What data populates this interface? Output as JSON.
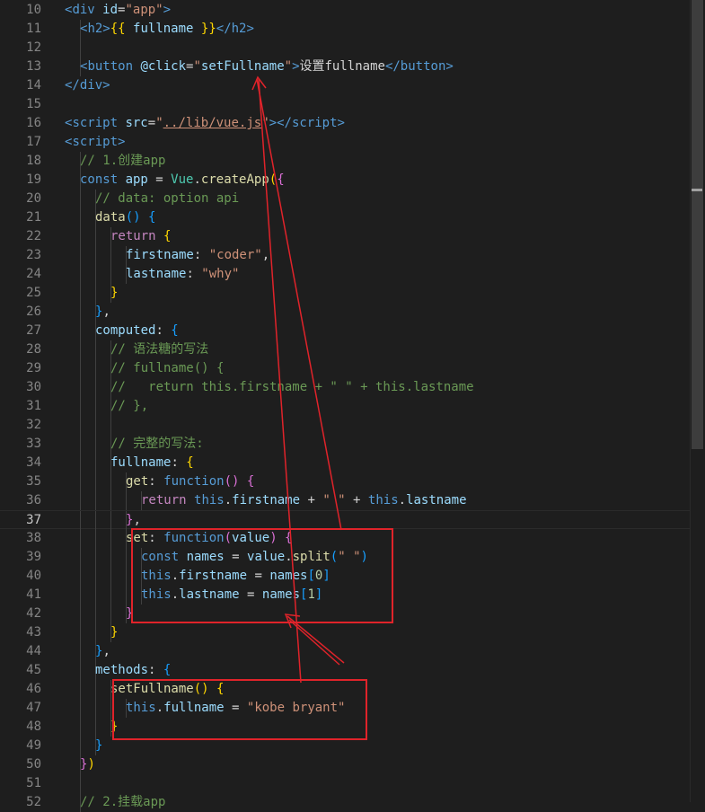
{
  "editor": {
    "current_line": 37,
    "lines": [
      {
        "n": "10",
        "indent": 1,
        "tokens": [
          [
            "<",
            "tag"
          ],
          [
            "div",
            "tag"
          ],
          [
            " ",
            ""
          ],
          [
            "id",
            "attr"
          ],
          [
            "=",
            "punc"
          ],
          [
            "\"app\"",
            "str"
          ],
          [
            ">",
            "tag"
          ]
        ]
      },
      {
        "n": "11",
        "indent": 2,
        "tokens": [
          [
            "<",
            "tag"
          ],
          [
            "h2",
            "tag"
          ],
          [
            ">",
            "tag"
          ],
          [
            "{{ ",
            "b1"
          ],
          [
            "fullname",
            "var"
          ],
          [
            " }}",
            "b1"
          ],
          [
            "</",
            "tag"
          ],
          [
            "h2",
            "tag"
          ],
          [
            ">",
            "tag"
          ]
        ]
      },
      {
        "n": "12",
        "indent": 2,
        "tokens": []
      },
      {
        "n": "13",
        "indent": 2,
        "tokens": [
          [
            "<",
            "tag"
          ],
          [
            "button",
            "tag"
          ],
          [
            " ",
            ""
          ],
          [
            "@click",
            "attr"
          ],
          [
            "=",
            "punc"
          ],
          [
            "\"",
            "str"
          ],
          [
            "setFullname",
            "var"
          ],
          [
            "\"",
            "str"
          ],
          [
            ">",
            "tag"
          ],
          [
            "设置fullname",
            "plain"
          ],
          [
            "</",
            "tag"
          ],
          [
            "button",
            "tag"
          ],
          [
            ">",
            "tag"
          ]
        ]
      },
      {
        "n": "14",
        "indent": 1,
        "tokens": [
          [
            "</",
            "tag"
          ],
          [
            "div",
            "tag"
          ],
          [
            ">",
            "tag"
          ]
        ]
      },
      {
        "n": "15",
        "indent": 0,
        "tokens": []
      },
      {
        "n": "16",
        "indent": 1,
        "tokens": [
          [
            "<",
            "tag"
          ],
          [
            "script",
            "tag"
          ],
          [
            " ",
            ""
          ],
          [
            "src",
            "attr"
          ],
          [
            "=",
            "punc"
          ],
          [
            "\"",
            "str"
          ],
          [
            "../lib/vue.js",
            "str link"
          ],
          [
            "\"",
            "str"
          ],
          [
            "></",
            "tag"
          ],
          [
            "script",
            "tag"
          ],
          [
            ">",
            "tag"
          ]
        ]
      },
      {
        "n": "17",
        "indent": 1,
        "tokens": [
          [
            "<",
            "tag"
          ],
          [
            "script",
            "tag"
          ],
          [
            ">",
            "tag"
          ]
        ]
      },
      {
        "n": "18",
        "indent": 2,
        "tokens": [
          [
            "// 1.创建app",
            "cmt"
          ]
        ]
      },
      {
        "n": "19",
        "indent": 2,
        "tokens": [
          [
            "const ",
            "kw"
          ],
          [
            "app",
            "var"
          ],
          [
            " = ",
            "plain"
          ],
          [
            "Vue",
            "cls"
          ],
          [
            ".",
            "plain"
          ],
          [
            "createApp",
            "fn"
          ],
          [
            "(",
            "b1"
          ],
          [
            "{",
            "b2"
          ]
        ]
      },
      {
        "n": "20",
        "indent": 3,
        "tokens": [
          [
            "// data: option api",
            "cmt"
          ]
        ]
      },
      {
        "n": "21",
        "indent": 3,
        "tokens": [
          [
            "data",
            "fn"
          ],
          [
            "() ",
            "b3"
          ],
          [
            "{",
            "b3"
          ]
        ]
      },
      {
        "n": "22",
        "indent": 4,
        "tokens": [
          [
            "return ",
            "ctrl"
          ],
          [
            "{",
            "b1"
          ]
        ]
      },
      {
        "n": "23",
        "indent": 5,
        "tokens": [
          [
            "firstname",
            "var"
          ],
          [
            ": ",
            "plain"
          ],
          [
            "\"coder\"",
            "str"
          ],
          [
            ",",
            "plain"
          ]
        ]
      },
      {
        "n": "24",
        "indent": 5,
        "tokens": [
          [
            "lastname",
            "var"
          ],
          [
            ": ",
            "plain"
          ],
          [
            "\"why\"",
            "str"
          ]
        ]
      },
      {
        "n": "25",
        "indent": 4,
        "tokens": [
          [
            "}",
            "b1"
          ]
        ]
      },
      {
        "n": "26",
        "indent": 3,
        "tokens": [
          [
            "}",
            "b3"
          ],
          [
            ",",
            "plain"
          ]
        ]
      },
      {
        "n": "27",
        "indent": 3,
        "tokens": [
          [
            "computed",
            "var"
          ],
          [
            ": ",
            "plain"
          ],
          [
            "{",
            "b3"
          ]
        ]
      },
      {
        "n": "28",
        "indent": 4,
        "tokens": [
          [
            "// 语法糖的写法",
            "cmt"
          ]
        ]
      },
      {
        "n": "29",
        "indent": 4,
        "tokens": [
          [
            "// fullname() {",
            "cmt"
          ]
        ]
      },
      {
        "n": "30",
        "indent": 4,
        "tokens": [
          [
            "//   return this.firstname + \" \" + this.lastname",
            "cmt"
          ]
        ]
      },
      {
        "n": "31",
        "indent": 4,
        "tokens": [
          [
            "// },",
            "cmt"
          ]
        ]
      },
      {
        "n": "32",
        "indent": 4,
        "tokens": []
      },
      {
        "n": "33",
        "indent": 4,
        "tokens": [
          [
            "// 完整的写法:",
            "cmt"
          ]
        ]
      },
      {
        "n": "34",
        "indent": 4,
        "tokens": [
          [
            "fullname",
            "var"
          ],
          [
            ": ",
            "plain"
          ],
          [
            "{",
            "b1"
          ]
        ]
      },
      {
        "n": "35",
        "indent": 5,
        "tokens": [
          [
            "get",
            "fn"
          ],
          [
            ": ",
            "plain"
          ],
          [
            "function",
            "kw"
          ],
          [
            "() ",
            "b2"
          ],
          [
            "{",
            "b2"
          ]
        ]
      },
      {
        "n": "36",
        "indent": 6,
        "tokens": [
          [
            "return ",
            "ctrl"
          ],
          [
            "this",
            "kw"
          ],
          [
            ".",
            "plain"
          ],
          [
            "firstname",
            "var"
          ],
          [
            " + ",
            "plain"
          ],
          [
            "\" \"",
            "str"
          ],
          [
            " + ",
            "plain"
          ],
          [
            "this",
            "kw"
          ],
          [
            ".",
            "plain"
          ],
          [
            "lastname",
            "var"
          ]
        ]
      },
      {
        "n": "37",
        "indent": 5,
        "tokens": [
          [
            "}",
            "b2"
          ],
          [
            ",",
            "plain"
          ]
        ]
      },
      {
        "n": "38",
        "indent": 5,
        "tokens": [
          [
            "set",
            "fn"
          ],
          [
            ": ",
            "plain"
          ],
          [
            "function",
            "kw"
          ],
          [
            "(",
            "b2"
          ],
          [
            "value",
            "var"
          ],
          [
            ") ",
            "b2"
          ],
          [
            "{",
            "b2"
          ]
        ]
      },
      {
        "n": "39",
        "indent": 6,
        "tokens": [
          [
            "const ",
            "kw"
          ],
          [
            "names",
            "var"
          ],
          [
            " = ",
            "plain"
          ],
          [
            "value",
            "var"
          ],
          [
            ".",
            "plain"
          ],
          [
            "split",
            "fn"
          ],
          [
            "(",
            "b3"
          ],
          [
            "\" \"",
            "str"
          ],
          [
            ")",
            "b3"
          ]
        ]
      },
      {
        "n": "40",
        "indent": 6,
        "tokens": [
          [
            "this",
            "kw"
          ],
          [
            ".",
            "plain"
          ],
          [
            "firstname",
            "var"
          ],
          [
            " = ",
            "plain"
          ],
          [
            "names",
            "var"
          ],
          [
            "[",
            "b3"
          ],
          [
            "0",
            "num"
          ],
          [
            "]",
            "b3"
          ]
        ]
      },
      {
        "n": "41",
        "indent": 6,
        "tokens": [
          [
            "this",
            "kw"
          ],
          [
            ".",
            "plain"
          ],
          [
            "lastname",
            "var"
          ],
          [
            " = ",
            "plain"
          ],
          [
            "names",
            "var"
          ],
          [
            "[",
            "b3"
          ],
          [
            "1",
            "num"
          ],
          [
            "]",
            "b3"
          ]
        ]
      },
      {
        "n": "42",
        "indent": 5,
        "tokens": [
          [
            "}",
            "b2"
          ]
        ]
      },
      {
        "n": "43",
        "indent": 4,
        "tokens": [
          [
            "}",
            "b1"
          ]
        ]
      },
      {
        "n": "44",
        "indent": 3,
        "tokens": [
          [
            "}",
            "b3"
          ],
          [
            ",",
            "plain"
          ]
        ]
      },
      {
        "n": "45",
        "indent": 3,
        "tokens": [
          [
            "methods",
            "var"
          ],
          [
            ": ",
            "plain"
          ],
          [
            "{",
            "b3"
          ]
        ]
      },
      {
        "n": "46",
        "indent": 4,
        "tokens": [
          [
            "setFullname",
            "fn"
          ],
          [
            "() ",
            "b1"
          ],
          [
            "{",
            "b1"
          ]
        ]
      },
      {
        "n": "47",
        "indent": 5,
        "tokens": [
          [
            "this",
            "kw"
          ],
          [
            ".",
            "plain"
          ],
          [
            "fullname",
            "var"
          ],
          [
            " = ",
            "plain"
          ],
          [
            "\"kobe bryant\"",
            "str"
          ]
        ]
      },
      {
        "n": "48",
        "indent": 4,
        "tokens": [
          [
            "}",
            "b1"
          ]
        ]
      },
      {
        "n": "49",
        "indent": 3,
        "tokens": [
          [
            "}",
            "b3"
          ]
        ]
      },
      {
        "n": "50",
        "indent": 2,
        "tokens": [
          [
            "}",
            "b2"
          ],
          [
            ")",
            "b1"
          ]
        ]
      },
      {
        "n": "51",
        "indent": 2,
        "tokens": []
      },
      {
        "n": "52",
        "indent": 2,
        "tokens": [
          [
            "// 2.挂载app",
            "cmt"
          ]
        ]
      }
    ]
  },
  "annotations": {
    "color": "#e0232a"
  }
}
